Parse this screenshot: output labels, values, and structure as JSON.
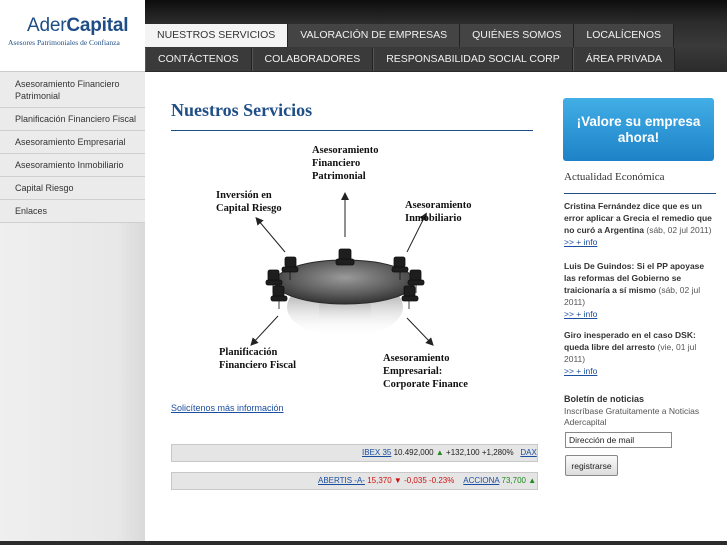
{
  "brand": {
    "name_part1": "Ader",
    "name_part2": "Capital",
    "tagline": "Asesores Patrimoniales de Confianza"
  },
  "nav": {
    "row1": [
      {
        "label": "NUESTROS SERVICIOS",
        "active": true
      },
      {
        "label": "VALORACIÓN DE EMPRESAS",
        "active": false
      },
      {
        "label": "QUIÉNES SOMOS",
        "active": false
      },
      {
        "label": "LOCALÍCENOS",
        "active": false
      }
    ],
    "row2": [
      {
        "label": "CONTÁCTENOS"
      },
      {
        "label": "COLABORADORES"
      },
      {
        "label": "RESPONSABILIDAD SOCIAL CORP"
      },
      {
        "label": "ÁREA PRIVADA"
      }
    ]
  },
  "sidebar": {
    "items": [
      {
        "label": "Asesoramiento Financiero Patrimonial"
      },
      {
        "label": "Planificación Financiero Fiscal"
      },
      {
        "label": "Asesoramiento Empresarial"
      },
      {
        "label": "Asesoramiento Inmobiliario"
      },
      {
        "label": "Capital Riesgo"
      },
      {
        "label": "Enlaces"
      }
    ]
  },
  "main": {
    "title": "Nuestros Servicios",
    "diagram": {
      "top": [
        "Asesoramiento",
        "Financiero",
        "Patrimonial"
      ],
      "upper_left": [
        "Inversión en",
        "Capital Riesgo"
      ],
      "upper_right": [
        "Asesoramiento",
        "Inmobiliario"
      ],
      "lower_left": [
        "Planificación",
        "Financiero Fiscal"
      ],
      "lower_right": [
        "Asesoramiento",
        "Empresarial:",
        "Corporate Finance"
      ]
    },
    "more_info_link": "Solicítenos más información"
  },
  "tickers": {
    "row1": [
      {
        "name": "IBEX 35",
        "price": "10.492,000",
        "dir": "up",
        "change": "+132,100",
        "pct": "+1,280%"
      },
      {
        "name": "DAX",
        "price": "",
        "dir": "",
        "change": "",
        "pct": ""
      }
    ],
    "row2": [
      {
        "name": "ABERTIS -A-",
        "price": "15,370",
        "dir": "down",
        "change": "-0,035",
        "pct": "-0.23%"
      },
      {
        "name": "ACCIONA",
        "price": "73,700",
        "dir": "up",
        "change": "+",
        "pct": ""
      }
    ],
    "up_color": "#1f8a1f",
    "down_color": "#d01010"
  },
  "right": {
    "cta_line1": "¡Valore su empresa",
    "cta_line2": "ahora!",
    "news_heading": "Actualidad Económica",
    "news": [
      {
        "headline": "Cristina Fernández dice que es un error aplicar a Grecia el remedio que no curó a Argentina",
        "date": "(sáb, 02 jul 2011)",
        "more": ">> + info"
      },
      {
        "headline": "Luis De Guindos: Si el PP apoyase las reformas del Gobierno se traicionaría a sí mismo",
        "date": "(sáb, 02 jul 2011)",
        "more": ">> + info"
      },
      {
        "headline": "Giro inesperado en el caso DSK: queda libre del arresto",
        "date": "(vie, 01 jul 2011)",
        "more": ">> + info"
      }
    ],
    "newsletter": {
      "title": "Boletín de noticias",
      "subtitle": "Inscríbase Gratuitamente a Noticias Adercapital",
      "email_value": "Dirección de mail",
      "button": "registrarse"
    }
  },
  "colors": {
    "brand_blue": "#1f4e86",
    "link_blue": "#1a4ea0",
    "cta_blue": "#2a96d8",
    "nav_dark": "#2b2b2b"
  }
}
